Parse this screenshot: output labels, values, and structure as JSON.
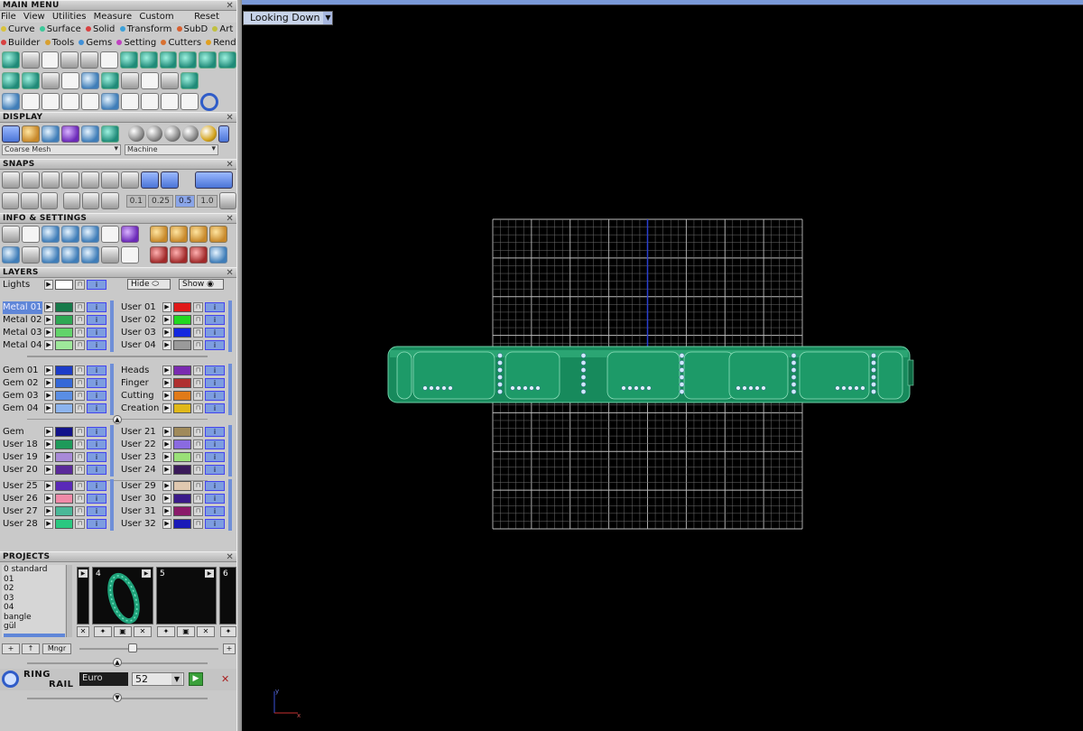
{
  "main_menu": {
    "header": "MAIN MENU",
    "menus": [
      "File",
      "View",
      "Utilities",
      "Measure",
      "Custom"
    ],
    "reset": "Reset",
    "categories_row1": [
      {
        "label": "Curve",
        "color": "#d8c23c"
      },
      {
        "label": "Surface",
        "color": "#3cc89a"
      },
      {
        "label": "Solid",
        "color": "#d84040"
      },
      {
        "label": "Transform",
        "color": "#3ca0d8"
      },
      {
        "label": "SubD",
        "color": "#d86030"
      },
      {
        "label": "Art",
        "color": "#c0c040"
      }
    ],
    "categories_row2": [
      {
        "label": "Builder",
        "color": "#d84040"
      },
      {
        "label": "Tools",
        "color": "#d8a030"
      },
      {
        "label": "Gems",
        "color": "#4090d8"
      },
      {
        "label": "Setting",
        "color": "#c040c0"
      },
      {
        "label": "Cutters",
        "color": "#d87030"
      },
      {
        "label": "Render",
        "color": "#e0a020"
      }
    ]
  },
  "display": {
    "header": "DISPLAY",
    "mesh_select": "Coarse Mesh",
    "material_select": "Machine"
  },
  "snaps": {
    "header": "SNAPS",
    "values": [
      "0.1",
      "0.25",
      "0.5",
      "1.0"
    ],
    "selected_value": "0.5"
  },
  "info": {
    "header": "INFO & SETTINGS"
  },
  "layers": {
    "header": "LAYERS",
    "lights_label": "Lights",
    "hide_label": "Hide",
    "show_label": "Show",
    "groups": [
      {
        "left": [
          {
            "name": "Metal 01",
            "color": "#167a4a",
            "selected": true
          },
          {
            "name": "Metal 02",
            "color": "#2fa854"
          },
          {
            "name": "Metal 03",
            "color": "#62d46a"
          },
          {
            "name": "Metal 04",
            "color": "#9ee89a"
          }
        ],
        "right": [
          {
            "name": "User 01",
            "color": "#e01818"
          },
          {
            "name": "User 02",
            "color": "#20d820"
          },
          {
            "name": "User 03",
            "color": "#1428e0"
          },
          {
            "name": "User 04",
            "color": "#9a9a9a"
          }
        ]
      },
      {
        "left": [
          {
            "name": "Gem 01",
            "color": "#1c3cc8"
          },
          {
            "name": "Gem 02",
            "color": "#3468d8"
          },
          {
            "name": "Gem 03",
            "color": "#5a8ee4"
          },
          {
            "name": "Gem 04",
            "color": "#8cb4ee"
          }
        ],
        "right": [
          {
            "name": "Heads",
            "color": "#7a2ab0"
          },
          {
            "name": "Finger",
            "color": "#b03030"
          },
          {
            "name": "Cutting",
            "color": "#e07a18"
          },
          {
            "name": "Creation",
            "color": "#e0b818"
          }
        ]
      },
      {
        "left": [
          {
            "name": "Gem",
            "color": "#12128a"
          },
          {
            "name": "User 18",
            "color": "#1e9a5a"
          },
          {
            "name": "User 19",
            "color": "#a88ad8"
          },
          {
            "name": "User 20",
            "color": "#5a2a9a"
          }
        ],
        "right": [
          {
            "name": "User 21",
            "color": "#a08a5a"
          },
          {
            "name": "User 22",
            "color": "#8a6ae0"
          },
          {
            "name": "User 23",
            "color": "#9ae078"
          },
          {
            "name": "User 24",
            "color": "#3a1a5a"
          }
        ]
      },
      {
        "left": [
          {
            "name": "User 25",
            "color": "#5a2ab8"
          },
          {
            "name": "User 26",
            "color": "#f08aa8"
          },
          {
            "name": "User 27",
            "color": "#4ab898"
          },
          {
            "name": "User 28",
            "color": "#2ac880"
          }
        ],
        "right": [
          {
            "name": "User 29",
            "color": "#e0c8b0"
          },
          {
            "name": "User 30",
            "color": "#3a1a8a"
          },
          {
            "name": "User 31",
            "color": "#8a1a6a"
          },
          {
            "name": "User 32",
            "color": "#1a1ab8"
          }
        ]
      }
    ]
  },
  "projects": {
    "header": "PROJECTS",
    "list": [
      "0 standard",
      "01",
      "02",
      "03",
      "04",
      "bangle",
      "gül"
    ],
    "thumb_numbers": [
      "4",
      "5",
      "6"
    ],
    "manager_label": "Mngr"
  },
  "ring_rail": {
    "label_line1": "RING",
    "label_line2": "RAIL",
    "size_system": "Euro",
    "size_value": "52"
  },
  "viewport": {
    "view_label": "Looking Down",
    "axis_y": "y",
    "axis_x": "x"
  }
}
